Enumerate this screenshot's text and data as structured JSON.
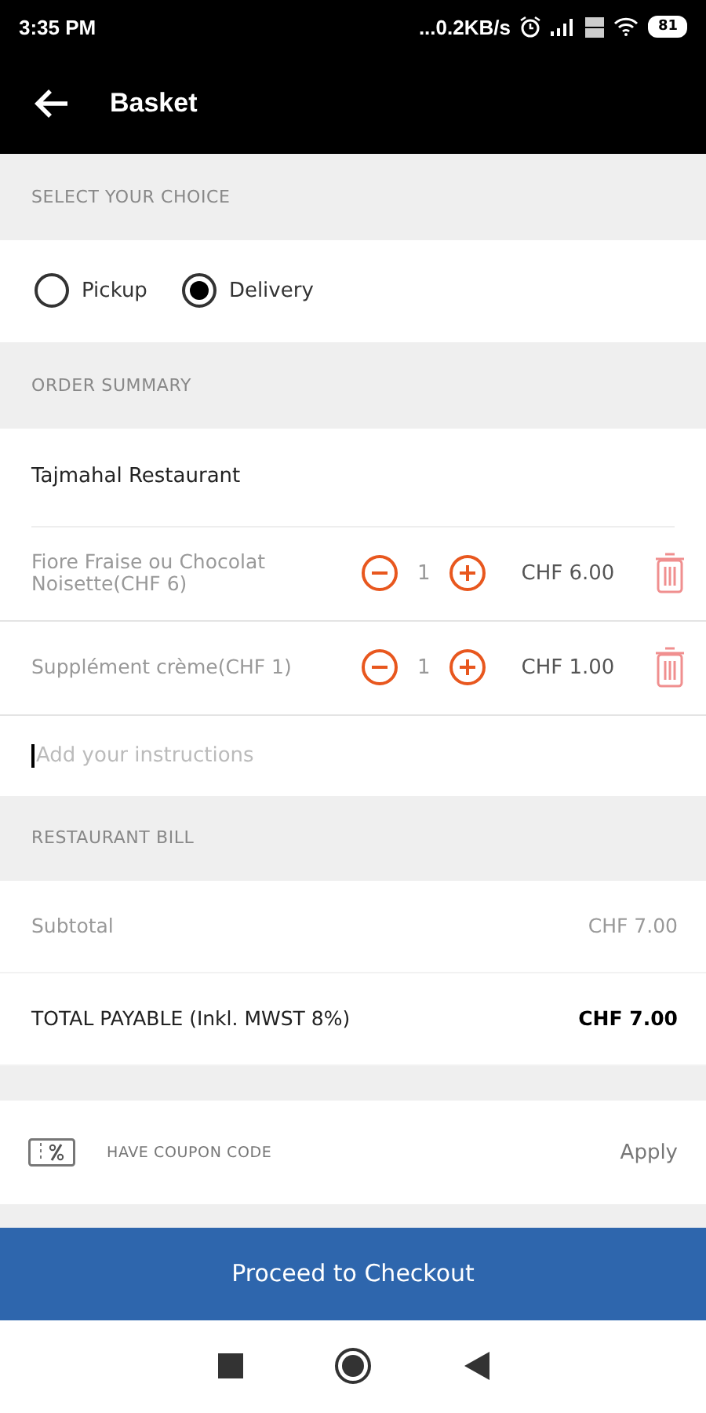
{
  "status_bar": {
    "time": "3:35 PM",
    "network_speed": "...0.2KB/s",
    "battery": "81"
  },
  "header": {
    "title": "Basket"
  },
  "choice_section": {
    "heading": "SELECT YOUR CHOICE",
    "options": [
      {
        "label": "Pickup",
        "selected": false
      },
      {
        "label": "Delivery",
        "selected": true
      }
    ]
  },
  "order_section": {
    "heading": "ORDER SUMMARY",
    "restaurant": "Tajmahal Restaurant",
    "items": [
      {
        "name": "Fiore Fraise ou Chocolat Noisette(CHF 6)",
        "quantity": "1",
        "price": "CHF 6.00"
      },
      {
        "name": "Supplément crème(CHF 1)",
        "quantity": "1",
        "price": "CHF 1.00"
      }
    ],
    "instructions": {
      "placeholder": "Add your instructions"
    }
  },
  "bill_section": {
    "heading": "RESTAURANT BILL",
    "rows": [
      {
        "label": "Subtotal",
        "value": "CHF 7.00",
        "kind": "normal"
      },
      {
        "label": "TOTAL PAYABLE (Inkl. MWST 8%)",
        "value": "CHF 7.00",
        "kind": "total"
      }
    ]
  },
  "coupon": {
    "label": "HAVE COUPON CODE",
    "action": "Apply"
  },
  "checkout_button": "Proceed to Checkout"
}
